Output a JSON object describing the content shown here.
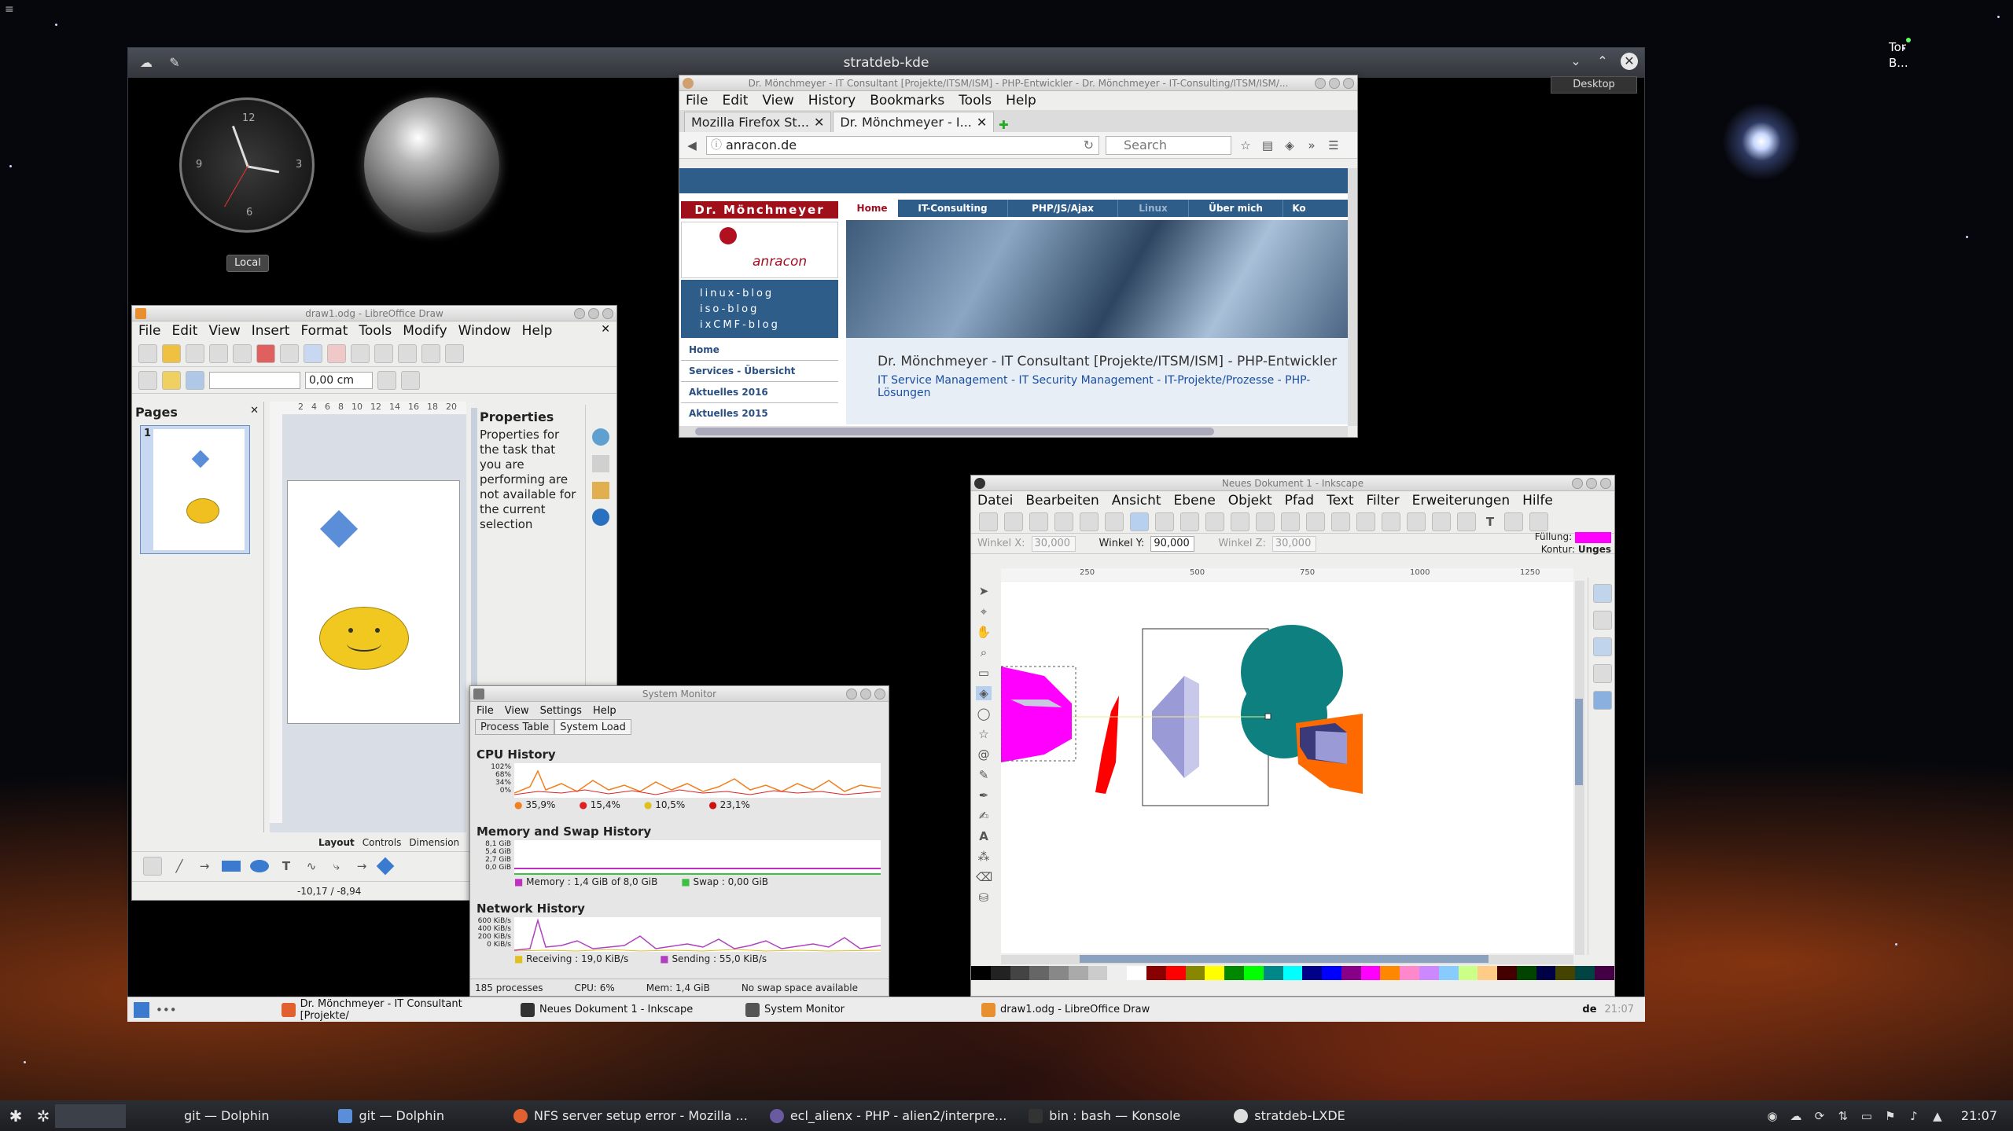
{
  "desktop": {
    "tor_label": "Tor\nB...",
    "desktop_button": "Desktop"
  },
  "kde_window": {
    "title": "stratdeb-kde"
  },
  "clock_widget": {
    "local_button": "Local",
    "numbers": [
      "12",
      "3",
      "6",
      "9"
    ]
  },
  "firefox": {
    "title": "Dr. Mönchmeyer - IT Consultant [Projekte/ITSM/ISM] - PHP-Entwickler - Dr. Mönchmeyer - IT-Consulting/ITSM/ISM/...",
    "menu": [
      "File",
      "Edit",
      "View",
      "History",
      "Bookmarks",
      "Tools",
      "Help"
    ],
    "tabs": [
      "Mozilla Firefox St...",
      "Dr. Mönchmeyer - I..."
    ],
    "url": "anracon.de",
    "search_placeholder": "Search",
    "site": {
      "brand": "Dr. Mönchmeyer",
      "logo_text": "anracon",
      "nav": [
        "Home",
        "IT-Consulting",
        "PHP/JS/Ajax",
        "Linux",
        "Über mich",
        "Ko"
      ],
      "blogs": [
        "linux-blog",
        "iso-blog",
        "ixCMF-blog"
      ],
      "side_links": [
        "Home",
        "Services - Übersicht",
        "Aktuelles 2016",
        "Aktuelles 2015"
      ],
      "headline": "Dr. Mönchmeyer - IT Consultant [Projekte/ITSM/ISM] - PHP-Entwickler",
      "subline": "IT Service Management - IT Security Management - IT-Projekte/Prozesse - PHP-Lösungen"
    }
  },
  "libreoffice": {
    "title": "draw1.odg - LibreOffice Draw",
    "menu": [
      "File",
      "Edit",
      "View",
      "Insert",
      "Format",
      "Tools",
      "Modify",
      "Window",
      "Help"
    ],
    "line_width": "0,00 cm",
    "pages_label": "Pages",
    "page_number": "1",
    "properties_label": "Properties",
    "properties_text": "Properties for the task that you are performing are not available for the current selection",
    "tabs": [
      "Layout",
      "Controls",
      "Dimension"
    ],
    "status_position": "-10,17 / -8,94",
    "ruler_numbers": [
      "2",
      "4",
      "6",
      "8",
      "10",
      "12",
      "14",
      "16",
      "18",
      "20"
    ]
  },
  "system_monitor": {
    "title": "System Monitor",
    "menu": [
      "File",
      "View",
      "Settings",
      "Help"
    ],
    "tabs": [
      "Process Table",
      "System Load"
    ],
    "cpu": {
      "heading": "CPU History",
      "axis": [
        "102%",
        "68%",
        "34%",
        "0%"
      ],
      "legend": [
        "35,9%",
        "15,4%",
        "10,5%",
        "23,1%"
      ],
      "colors": [
        "#f08020",
        "#e02020",
        "#e0c020",
        "#d01010"
      ]
    },
    "memory": {
      "heading": "Memory and Swap History",
      "axis": [
        "8,1 GiB",
        "5,4 GiB",
        "2,7 GiB",
        "0,0 GiB"
      ],
      "memory_legend": "Memory : 1,4 GiB of 8,0 GiB",
      "swap_legend": "Swap : 0,00 GiB"
    },
    "network": {
      "heading": "Network History",
      "axis": [
        "600 KiB/s",
        "400 KiB/s",
        "200 KiB/s",
        "0 KiB/s"
      ],
      "receiving": "Receiving : 19,0 KiB/s",
      "sending": "Sending : 55,0 KiB/s"
    },
    "status": {
      "processes": "185 processes",
      "cpu": "CPU: 6%",
      "mem": "Mem: 1,4 GiB",
      "swap": "No swap space available"
    }
  },
  "inkscape": {
    "title": "Neues Dokument 1 - Inkscape",
    "menu": [
      "Datei",
      "Bearbeiten",
      "Ansicht",
      "Ebene",
      "Objekt",
      "Pfad",
      "Text",
      "Filter",
      "Erweiterungen",
      "Hilfe"
    ],
    "winkel_x_label": "Winkel X:",
    "winkel_x": "30,000",
    "winkel_y_label": "Winkel Y:",
    "winkel_y": "90,000",
    "winkel_z_label": "Winkel Z:",
    "winkel_z": "30,000",
    "fill_label": "Füllung:",
    "stroke_label": "Kontur:",
    "stroke_value": "Unges",
    "fill_color": "#ff00ff",
    "ruler_numbers": [
      "250",
      "500",
      "750",
      "1000",
      "1250"
    ]
  },
  "inner_taskbar": {
    "tasks": [
      "Dr. Mönchmeyer - IT Consultant [Projekte/",
      "Neues Dokument 1 - Inkscape",
      "System Monitor",
      "draw1.odg - LibreOffice Draw"
    ],
    "lang": "de",
    "time": "21:07"
  },
  "panel": {
    "tasks": [
      "git — Dolphin",
      "git — Dolphin",
      "NFS server setup error - Mozilla ...",
      "ecl_alienx - PHP - alien2/interpre...",
      "bin : bash — Konsole",
      "stratdeb-LXDE"
    ],
    "time": "21:07"
  }
}
